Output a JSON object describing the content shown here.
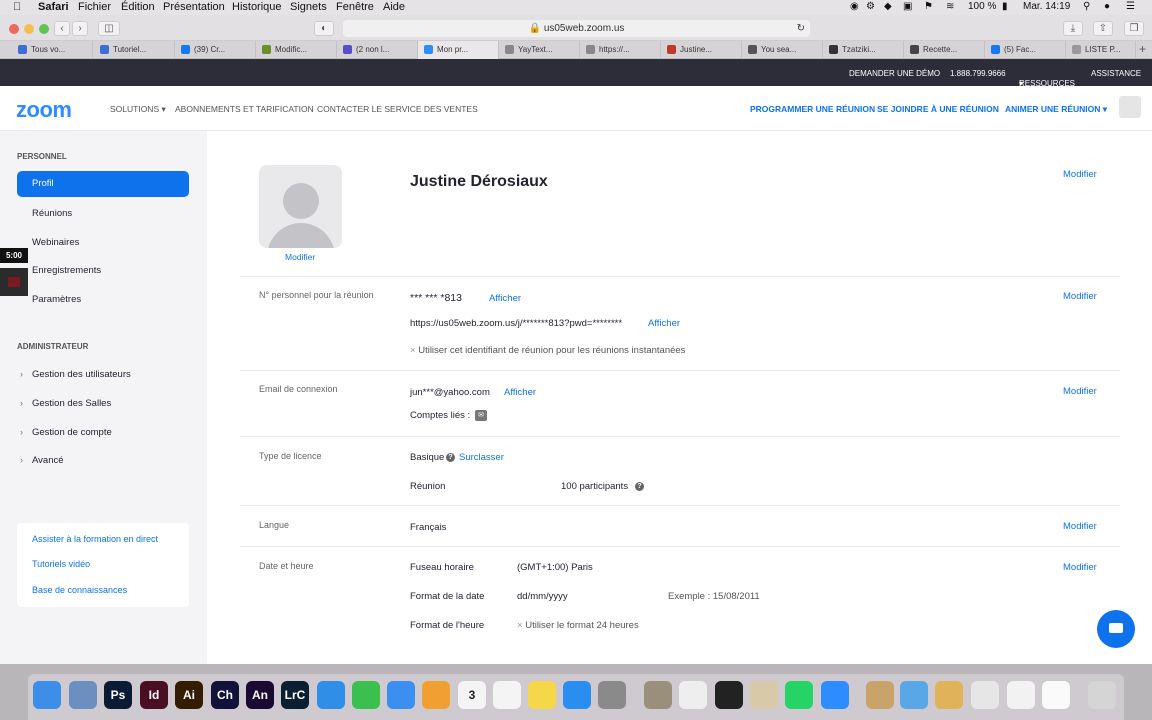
{
  "menubar": {
    "apple": "",
    "app": "Safari",
    "items": [
      "Fichier",
      "Édition",
      "Présentation",
      "Historique",
      "Signets",
      "Fenêtre",
      "Aide"
    ],
    "battery": "100 %",
    "clock": "Mar. 14:19"
  },
  "browser": {
    "url": "us05web.zoom.us",
    "tabs": [
      {
        "label": "Tous vo...",
        "color": "#3b6fd4"
      },
      {
        "label": "Tutoriel...",
        "color": "#3b6fd4"
      },
      {
        "label": "(39) Cr...",
        "color": "#1877f2"
      },
      {
        "label": "Modific...",
        "color": "#6a8f2a"
      },
      {
        "label": "(2 non l...",
        "color": "#5a4fc4"
      },
      {
        "label": "Mon pr...",
        "color": "#2d8cff"
      },
      {
        "label": "YayText...",
        "color": "#888888"
      },
      {
        "label": "https://...",
        "color": "#888888"
      },
      {
        "label": "Justine...",
        "color": "#c0392b"
      },
      {
        "label": "You sea...",
        "color": "#555555"
      },
      {
        "label": "Tzatziki...",
        "color": "#333333"
      },
      {
        "label": "Recette...",
        "color": "#444444"
      },
      {
        "label": "(5) Fac...",
        "color": "#1877f2"
      },
      {
        "label": "LISTE P...",
        "color": "#999999"
      }
    ]
  },
  "topbar": {
    "demo": "DEMANDER UNE DÉMO",
    "phone": "1.888.799.9666",
    "resources": "RESSOURCES",
    "support": "ASSISTANCE"
  },
  "nav": {
    "logo": "zoom",
    "solutions": "SOLUTIONS",
    "plans": "ABONNEMENTS ET TARIFICATION",
    "sales": "CONTACTER LE SERVICE DES VENTES",
    "schedule": "PROGRAMMER UNE RÉUNION",
    "join": "SE JOINDRE À UNE RÉUNION",
    "host": "ANIMER UNE RÉUNION"
  },
  "sidebar": {
    "personal_header": "PERSONNEL",
    "personal_items": [
      "Profil",
      "Réunions",
      "Webinaires",
      "Enregistrements",
      "Paramètres"
    ],
    "admin_header": "ADMINISTRATEUR",
    "admin_items": [
      "Gestion des utilisateurs",
      "Gestion des Salles",
      "Gestion de compte",
      "Avancé"
    ],
    "help_links": [
      "Assister à la formation en direct",
      "Tutoriels vidéo",
      "Base de connaissances"
    ]
  },
  "timer": "5:00",
  "profile": {
    "name": "Justine Dérosiaux",
    "avatar_edit": "Modifier",
    "edit": "Modifier",
    "pmi": {
      "label": "N° personnel pour la réunion",
      "value": "*** *** *813",
      "show": "Afficher",
      "url": "https://us05web.zoom.us/j/*******813?pwd=********",
      "url_show": "Afficher",
      "instant": "Utiliser cet identifiant de réunion pour les réunions instantanées"
    },
    "email": {
      "label": "Email de connexion",
      "value": "jun***@yahoo.com",
      "show": "Afficher",
      "linked": "Comptes liés :"
    },
    "license": {
      "label": "Type de licence",
      "value": "Basique",
      "upgrade": "Surclasser",
      "meeting_label": "Réunion",
      "meeting_value": "100 participants"
    },
    "language": {
      "label": "Langue",
      "value": "Français"
    },
    "datetime": {
      "label": "Date et heure",
      "tz_label": "Fuseau horaire",
      "tz_value": "(GMT+1:00) Paris",
      "date_label": "Format de la date",
      "date_value": "dd/mm/yyyy",
      "example": "Exemple :  15/08/2011",
      "time_label": "Format de l'heure",
      "time_value": "Utiliser le format 24 heures"
    }
  },
  "dock": {
    "apps": [
      {
        "name": "finder-icon",
        "label": "",
        "color": "#3d8ee8"
      },
      {
        "name": "preview-icon",
        "label": "",
        "color": "#6a8fc0"
      },
      {
        "name": "photoshop-icon",
        "label": "Ps",
        "color": "#0b1b33"
      },
      {
        "name": "indesign-icon",
        "label": "Id",
        "color": "#4a0e23"
      },
      {
        "name": "illustrator-icon",
        "label": "Ai",
        "color": "#331c00"
      },
      {
        "name": "character-animator-icon",
        "label": "Ch",
        "color": "#11113a"
      },
      {
        "name": "animate-icon",
        "label": "An",
        "color": "#1a0a33"
      },
      {
        "name": "lightroom-classic-icon",
        "label": "LrC",
        "color": "#0b1f33"
      },
      {
        "name": "safari-icon",
        "label": "",
        "color": "#2f8fe8"
      },
      {
        "name": "facetime-icon",
        "label": "",
        "color": "#3bbf4f"
      },
      {
        "name": "messages-icon",
        "label": "",
        "color": "#3a8ff0"
      },
      {
        "name": "photos-icon",
        "label": "",
        "color": "#f0a030"
      },
      {
        "name": "calendar-icon",
        "label": "3",
        "color": "#f4f4f4"
      },
      {
        "name": "reminders-icon",
        "label": "",
        "color": "#f4f4f4"
      },
      {
        "name": "notes-icon",
        "label": "",
        "color": "#f7d74a"
      },
      {
        "name": "app-store-icon",
        "label": "",
        "color": "#2a8ef0"
      },
      {
        "name": "system-preferences-icon",
        "label": "",
        "color": "#8a8a8a"
      },
      {
        "name": "utility-icon",
        "label": "",
        "color": "#9a8f7a"
      },
      {
        "name": "textedit-icon",
        "label": "",
        "color": "#eeeeee"
      },
      {
        "name": "activity-monitor-icon",
        "label": "",
        "color": "#222222"
      },
      {
        "name": "reader-icon",
        "label": "",
        "color": "#d8c9a8"
      },
      {
        "name": "whatsapp-icon",
        "label": "",
        "color": "#25d366"
      },
      {
        "name": "zoom-icon",
        "label": "",
        "color": "#2d8cff"
      },
      {
        "name": "home-folder-icon",
        "label": "",
        "color": "#c9a36a"
      },
      {
        "name": "downloads-folder-icon",
        "label": "",
        "color": "#5aa7e8"
      },
      {
        "name": "archive-icon",
        "label": "",
        "color": "#e0b35a"
      },
      {
        "name": "document-icon-1",
        "label": "",
        "color": "#e6e6e6"
      },
      {
        "name": "document-icon-2",
        "label": "",
        "color": "#f2f2f2"
      },
      {
        "name": "document-icon-3",
        "label": "",
        "color": "#fafafa"
      },
      {
        "name": "trash-icon",
        "label": "",
        "color": "#d5d5d5"
      }
    ]
  }
}
